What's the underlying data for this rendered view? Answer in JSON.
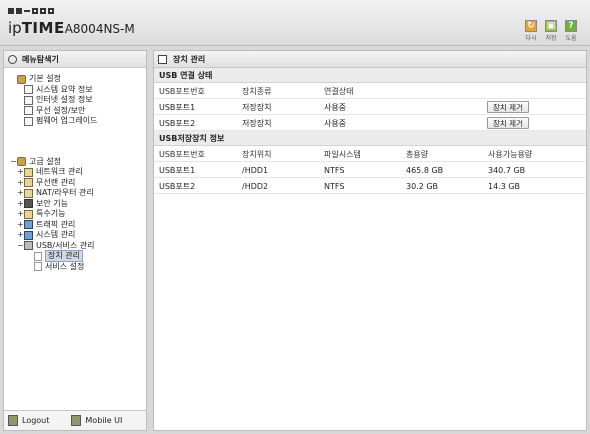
{
  "header": {
    "brand_prefix": "ip",
    "brand_time": "TIME",
    "model": "A8004NS-M",
    "buttons": {
      "reload": "다시",
      "save": "저장",
      "help": "도움"
    }
  },
  "sidebar": {
    "title": "메뉴탐색기",
    "basic": {
      "label": "기본 설정",
      "items": [
        "시스템 요약 정보",
        "인터넷 설정 정보",
        "무선 설정/보안",
        "펌웨어 업그레이드"
      ]
    },
    "advanced": {
      "label": "고급 설정",
      "items": [
        "네트워크 관리",
        "무선랜 관리",
        "NAT/라우터 관리",
        "보안 기능",
        "특수기능",
        "트래픽 관리",
        "시스템 관리",
        "USB/서비스 관리"
      ],
      "usb_sub": [
        "장치 관리",
        "서비스 설정"
      ]
    },
    "footer": {
      "logout": "Logout",
      "mobile": "Mobile UI"
    }
  },
  "main": {
    "title": "장치 관리",
    "connection": {
      "title": "USB 연결 상태",
      "headers": [
        "USB포트번호",
        "장치종류",
        "연결상태"
      ],
      "rows": [
        {
          "port": "USB포트1",
          "type": "저장장치",
          "status": "사용중",
          "action": "장치 제거"
        },
        {
          "port": "USB포트2",
          "type": "저장장치",
          "status": "사용중",
          "action": "장치 제거"
        }
      ]
    },
    "storage": {
      "title": "USB저장장치 정보",
      "headers": [
        "USB포트번호",
        "장치위치",
        "파일시스템",
        "총용량",
        "사용가능용량"
      ],
      "rows": [
        {
          "port": "USB포트1",
          "location": "/HDD1",
          "fs": "NTFS",
          "total": "465.8 GB",
          "avail": "340.7 GB"
        },
        {
          "port": "USB포트2",
          "location": "/HDD2",
          "fs": "NTFS",
          "total": "30.2 GB",
          "avail": "14.3 GB"
        }
      ]
    }
  }
}
